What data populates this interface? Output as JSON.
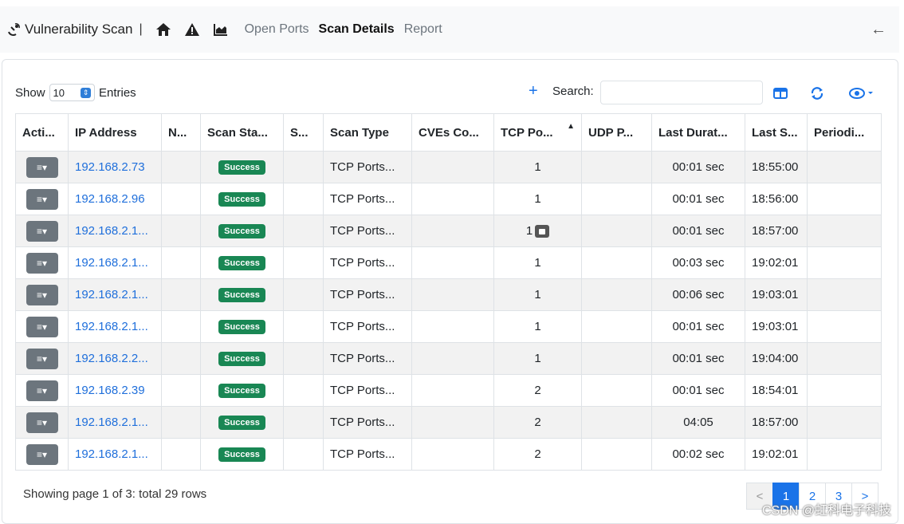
{
  "nav": {
    "brand": "Vulnerability Scan",
    "separator": "|",
    "links": [
      "Open Ports",
      "Scan Details",
      "Report"
    ],
    "active": "Scan Details"
  },
  "toolbar": {
    "show_label": "Show",
    "page_size": "10",
    "entries_label": "Entries",
    "search_label": "Search:",
    "search_value": ""
  },
  "table": {
    "headers": [
      "Acti...",
      "IP Address",
      "N...",
      "Scan Sta...",
      "S...",
      "Scan Type",
      "CVEs Co...",
      "TCP Po...",
      "UDP P...",
      "Last Durat...",
      "Last S...",
      "Periodi..."
    ],
    "rows": [
      {
        "ip": "192.168.2.73",
        "status": "Success",
        "type": "TCP Ports...",
        "tcp": "1",
        "duration": "00:01 sec",
        "last": "18:55:00"
      },
      {
        "ip": "192.168.2.96",
        "status": "Success",
        "type": "TCP Ports...",
        "tcp": "1",
        "duration": "00:01 sec",
        "last": "18:56:00"
      },
      {
        "ip": "192.168.2.1...",
        "status": "Success",
        "type": "TCP Ports...",
        "tcp": "1",
        "duration": "00:01 sec",
        "last": "18:57:00"
      },
      {
        "ip": "192.168.2.1...",
        "status": "Success",
        "type": "TCP Ports...",
        "tcp": "1",
        "duration": "00:03 sec",
        "last": "19:02:01"
      },
      {
        "ip": "192.168.2.1...",
        "status": "Success",
        "type": "TCP Ports...",
        "tcp": "1",
        "duration": "00:06 sec",
        "last": "19:03:01"
      },
      {
        "ip": "192.168.2.1...",
        "status": "Success",
        "type": "TCP Ports...",
        "tcp": "1",
        "duration": "00:01 sec",
        "last": "19:03:01"
      },
      {
        "ip": "192.168.2.2...",
        "status": "Success",
        "type": "TCP Ports...",
        "tcp": "1",
        "duration": "00:01 sec",
        "last": "19:04:00"
      },
      {
        "ip": "192.168.2.39",
        "status": "Success",
        "type": "TCP Ports...",
        "tcp": "2",
        "duration": "00:01 sec",
        "last": "18:54:01"
      },
      {
        "ip": "192.168.2.1...",
        "status": "Success",
        "type": "TCP Ports...",
        "tcp": "2",
        "duration": "04:05",
        "last": "18:57:00"
      },
      {
        "ip": "192.168.2.1...",
        "status": "Success",
        "type": "TCP Ports...",
        "tcp": "2",
        "duration": "00:02 sec",
        "last": "19:02:01"
      }
    ]
  },
  "footer": {
    "summary": "Showing page 1 of 3: total 29 rows",
    "pages": [
      "<",
      "1",
      "2",
      "3",
      ">"
    ]
  },
  "watermark": "CSDN @虹科电子科技",
  "colors": {
    "link": "#1f6fdb",
    "success": "#198754",
    "accent": "#1a73e8",
    "action": "#6c757d"
  },
  "icons": [
    "radar-icon",
    "home-icon",
    "warning-icon",
    "chart-icon",
    "arrow-left-icon",
    "plus-icon",
    "columns-icon",
    "refresh-icon",
    "eye-icon",
    "sort-up-icon",
    "lock-icon",
    "list-icon"
  ]
}
